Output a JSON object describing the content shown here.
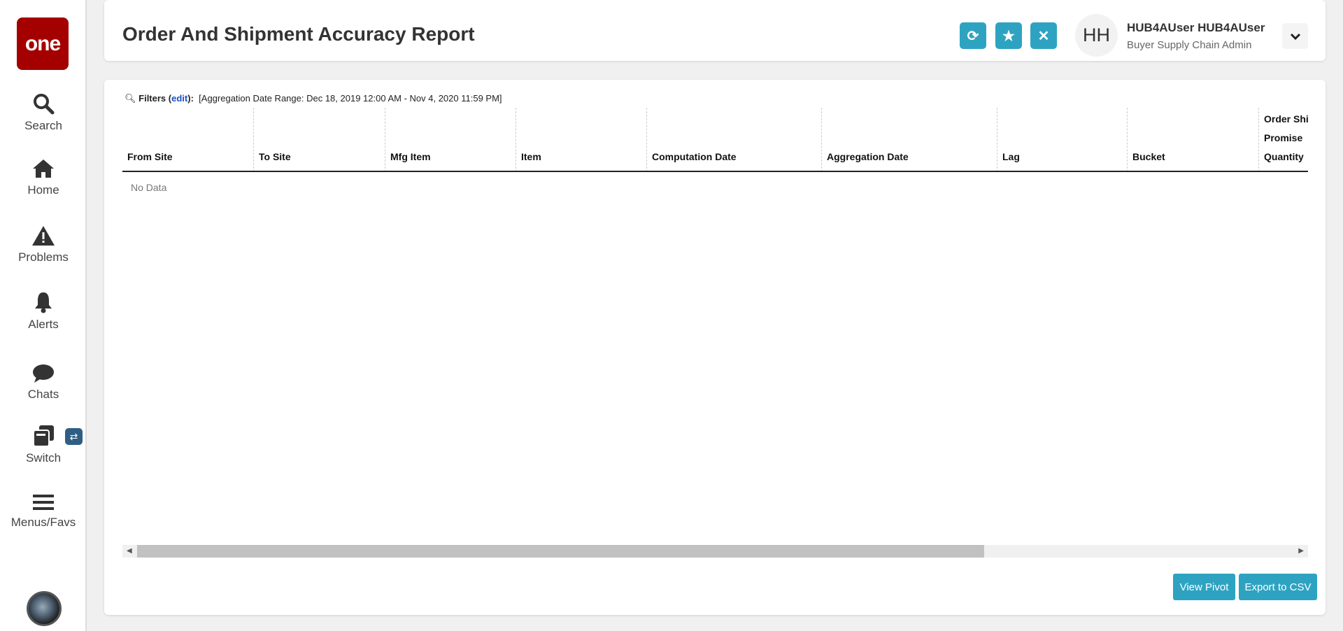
{
  "sidebar": {
    "logo": "one",
    "items": [
      {
        "label": "Search"
      },
      {
        "label": "Home"
      },
      {
        "label": "Problems"
      },
      {
        "label": "Alerts"
      },
      {
        "label": "Chats"
      },
      {
        "label": "Switch"
      },
      {
        "label": "Menus/Favs"
      }
    ]
  },
  "header": {
    "title": "Order And Shipment Accuracy Report",
    "user_initials": "HH",
    "user_name": "HUB4AUser HUB4AUser",
    "user_role": "Buyer Supply Chain Admin"
  },
  "filters": {
    "label": "Filters",
    "edit": "edit",
    "text": "[Aggregation Date Range: Dec 18, 2019 12:00 AM - Nov 4, 2020 11:59 PM]"
  },
  "table": {
    "columns": [
      "From Site",
      "To Site",
      "Mfg Item",
      "Item",
      "Computation Date",
      "Aggregation Date",
      "Lag",
      "Bucket"
    ],
    "last_column": [
      "Order Shi",
      "Promise",
      "Quantity"
    ],
    "empty": "No Data"
  },
  "scrollbar": {
    "position_fraction": 0.0
  },
  "actions": {
    "view_pivot": "View Pivot",
    "export_csv": "Export to CSV"
  },
  "colors": {
    "accent": "#2ea3c1",
    "logo": "#a50000"
  }
}
